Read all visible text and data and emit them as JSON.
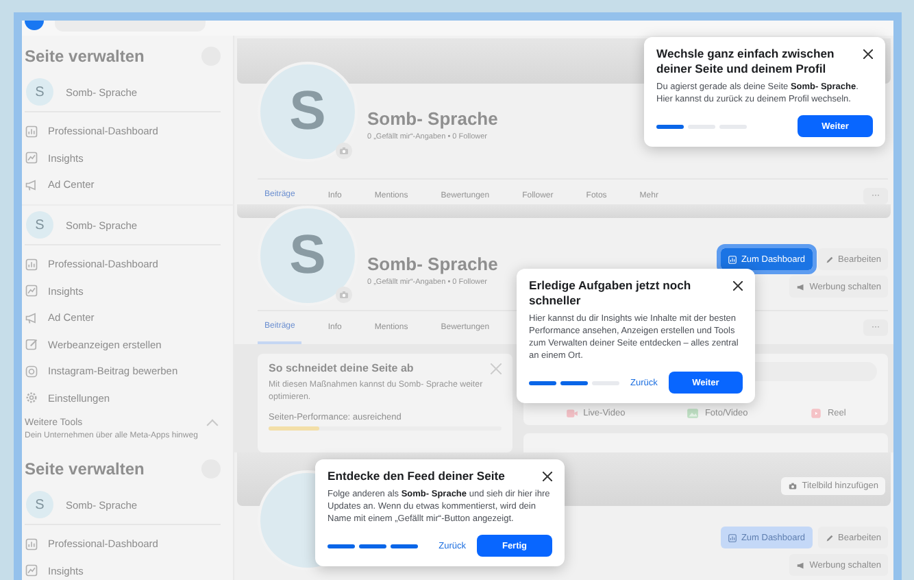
{
  "panels": [
    {
      "sidebar": {
        "title": "Seite verwalten",
        "page": {
          "initial": "S",
          "name": "Somb- Sprache"
        },
        "items": [
          {
            "label": "Professional-Dashboard",
            "kind": "dashboard"
          },
          {
            "label": "Insights",
            "kind": "insights"
          },
          {
            "label": "Ad Center",
            "kind": "megaphone"
          }
        ]
      },
      "header": {
        "initial": "S",
        "name": "Somb- Sprache",
        "stats": "0 „Gefällt mir“-Angaben • 0 Follower"
      },
      "tabs": [
        {
          "label": "Beiträge",
          "selected": true
        },
        {
          "label": "Info",
          "selected": false
        },
        {
          "label": "Mentions",
          "selected": false
        },
        {
          "label": "Bewertungen",
          "selected": false
        },
        {
          "label": "Follower",
          "selected": false
        },
        {
          "label": "Fotos",
          "selected": false
        },
        {
          "label": "Mehr",
          "selected": false
        }
      ],
      "more_button": "···"
    },
    {
      "sidebar": {
        "page": {
          "initial": "S",
          "name": "Somb- Sprache"
        },
        "items": [
          {
            "label": "Professional-Dashboard",
            "kind": "dashboard"
          },
          {
            "label": "Insights",
            "kind": "insights"
          },
          {
            "label": "Ad Center",
            "kind": "megaphone"
          },
          {
            "label": "Werbeanzeigen erstellen",
            "kind": "pencil"
          },
          {
            "label": "Instagram-Beitrag bewerben",
            "kind": "instagram"
          },
          {
            "label": "Einstellungen",
            "kind": "gear"
          }
        ],
        "tools": {
          "title": "Weitere Tools",
          "subtitle": "Dein Unternehmen über alle Meta-Apps hinweg"
        }
      },
      "header": {
        "initial": "S",
        "name": "Somb- Sprache",
        "stats": "0 „Gefällt mir“-Angaben • 0 Follower",
        "actions": [
          {
            "label": "Zum Dashboard",
            "kind": "dashboard",
            "highlighted": true
          },
          {
            "label": "Bearbeiten",
            "kind": "edit",
            "highlighted": false
          },
          {
            "label": "Werbung schalten",
            "kind": "ad",
            "highlighted": false
          }
        ]
      },
      "tabs": [
        {
          "label": "Beiträge",
          "selected": true
        },
        {
          "label": "Info",
          "selected": false
        },
        {
          "label": "Mentions",
          "selected": false
        },
        {
          "label": "Bewertungen",
          "selected": false
        }
      ],
      "more_button": "···",
      "performance": {
        "title": "So schneidet deine Seite ab",
        "text": "Mit diesen Maßnahmen kannst du Somb- Sprache weiter optimieren.",
        "rating": "Seiten-Performance: ausreichend",
        "level": 0.22
      },
      "composer": {
        "options": [
          {
            "label": "Live-Video",
            "kind": "live"
          },
          {
            "label": "Foto/Video",
            "kind": "photo"
          },
          {
            "label": "Reel",
            "kind": "reel"
          }
        ]
      }
    },
    {
      "sidebar": {
        "title": "Seite verwalten",
        "page": {
          "initial": "S",
          "name": "Somb- Sprache"
        },
        "items": [
          {
            "label": "Professional-Dashboard",
            "kind": "dashboard"
          },
          {
            "label": "Insights",
            "kind": "insights"
          }
        ]
      },
      "cover_button": "Titelbild hinzufügen",
      "header": {
        "actions": [
          {
            "label": "Zum Dashboard",
            "kind": "dashboard",
            "highlighted": false
          },
          {
            "label": "Bearbeiten",
            "kind": "edit",
            "highlighted": false
          },
          {
            "label": "Werbung schalten",
            "kind": "ad",
            "highlighted": false
          }
        ]
      }
    }
  ],
  "popups": [
    {
      "title": "Wechsle ganz einfach zwischen deiner Seite und deinem Profil",
      "body": "Du agierst gerade als deine Seite **Somb- Sprache**. Hier kannst du zurück zu deinem Profil wechseln.",
      "steps": [
        {
          "completed": true
        },
        {
          "completed": false
        },
        {
          "completed": false
        }
      ],
      "primary": "Weiter"
    },
    {
      "title": "Erledige Aufgaben jetzt noch schneller",
      "body": "Hier kannst du dir Insights wie Inhalte mit der besten Performance ansehen, Anzeigen erstellen und Tools zum Verwalten deiner Seite entdecken – alles zentral an einem Ort.",
      "steps": [
        {
          "completed": true
        },
        {
          "completed": true
        },
        {
          "completed": false
        }
      ],
      "back": "Zurück",
      "primary": "Weiter"
    },
    {
      "title": "Entdecke den Feed deiner Seite",
      "body": "Folge anderen als **Somb- Sprache** und sieh dir hier ihre Updates an. Wenn du etwas kommentierst, wird dein Name mit einem „Gefällt mir“-Button angezeigt.",
      "steps": [
        {
          "completed": true
        },
        {
          "completed": true
        },
        {
          "completed": true
        }
      ],
      "back": "Zurück",
      "primary": "Fertig"
    }
  ]
}
